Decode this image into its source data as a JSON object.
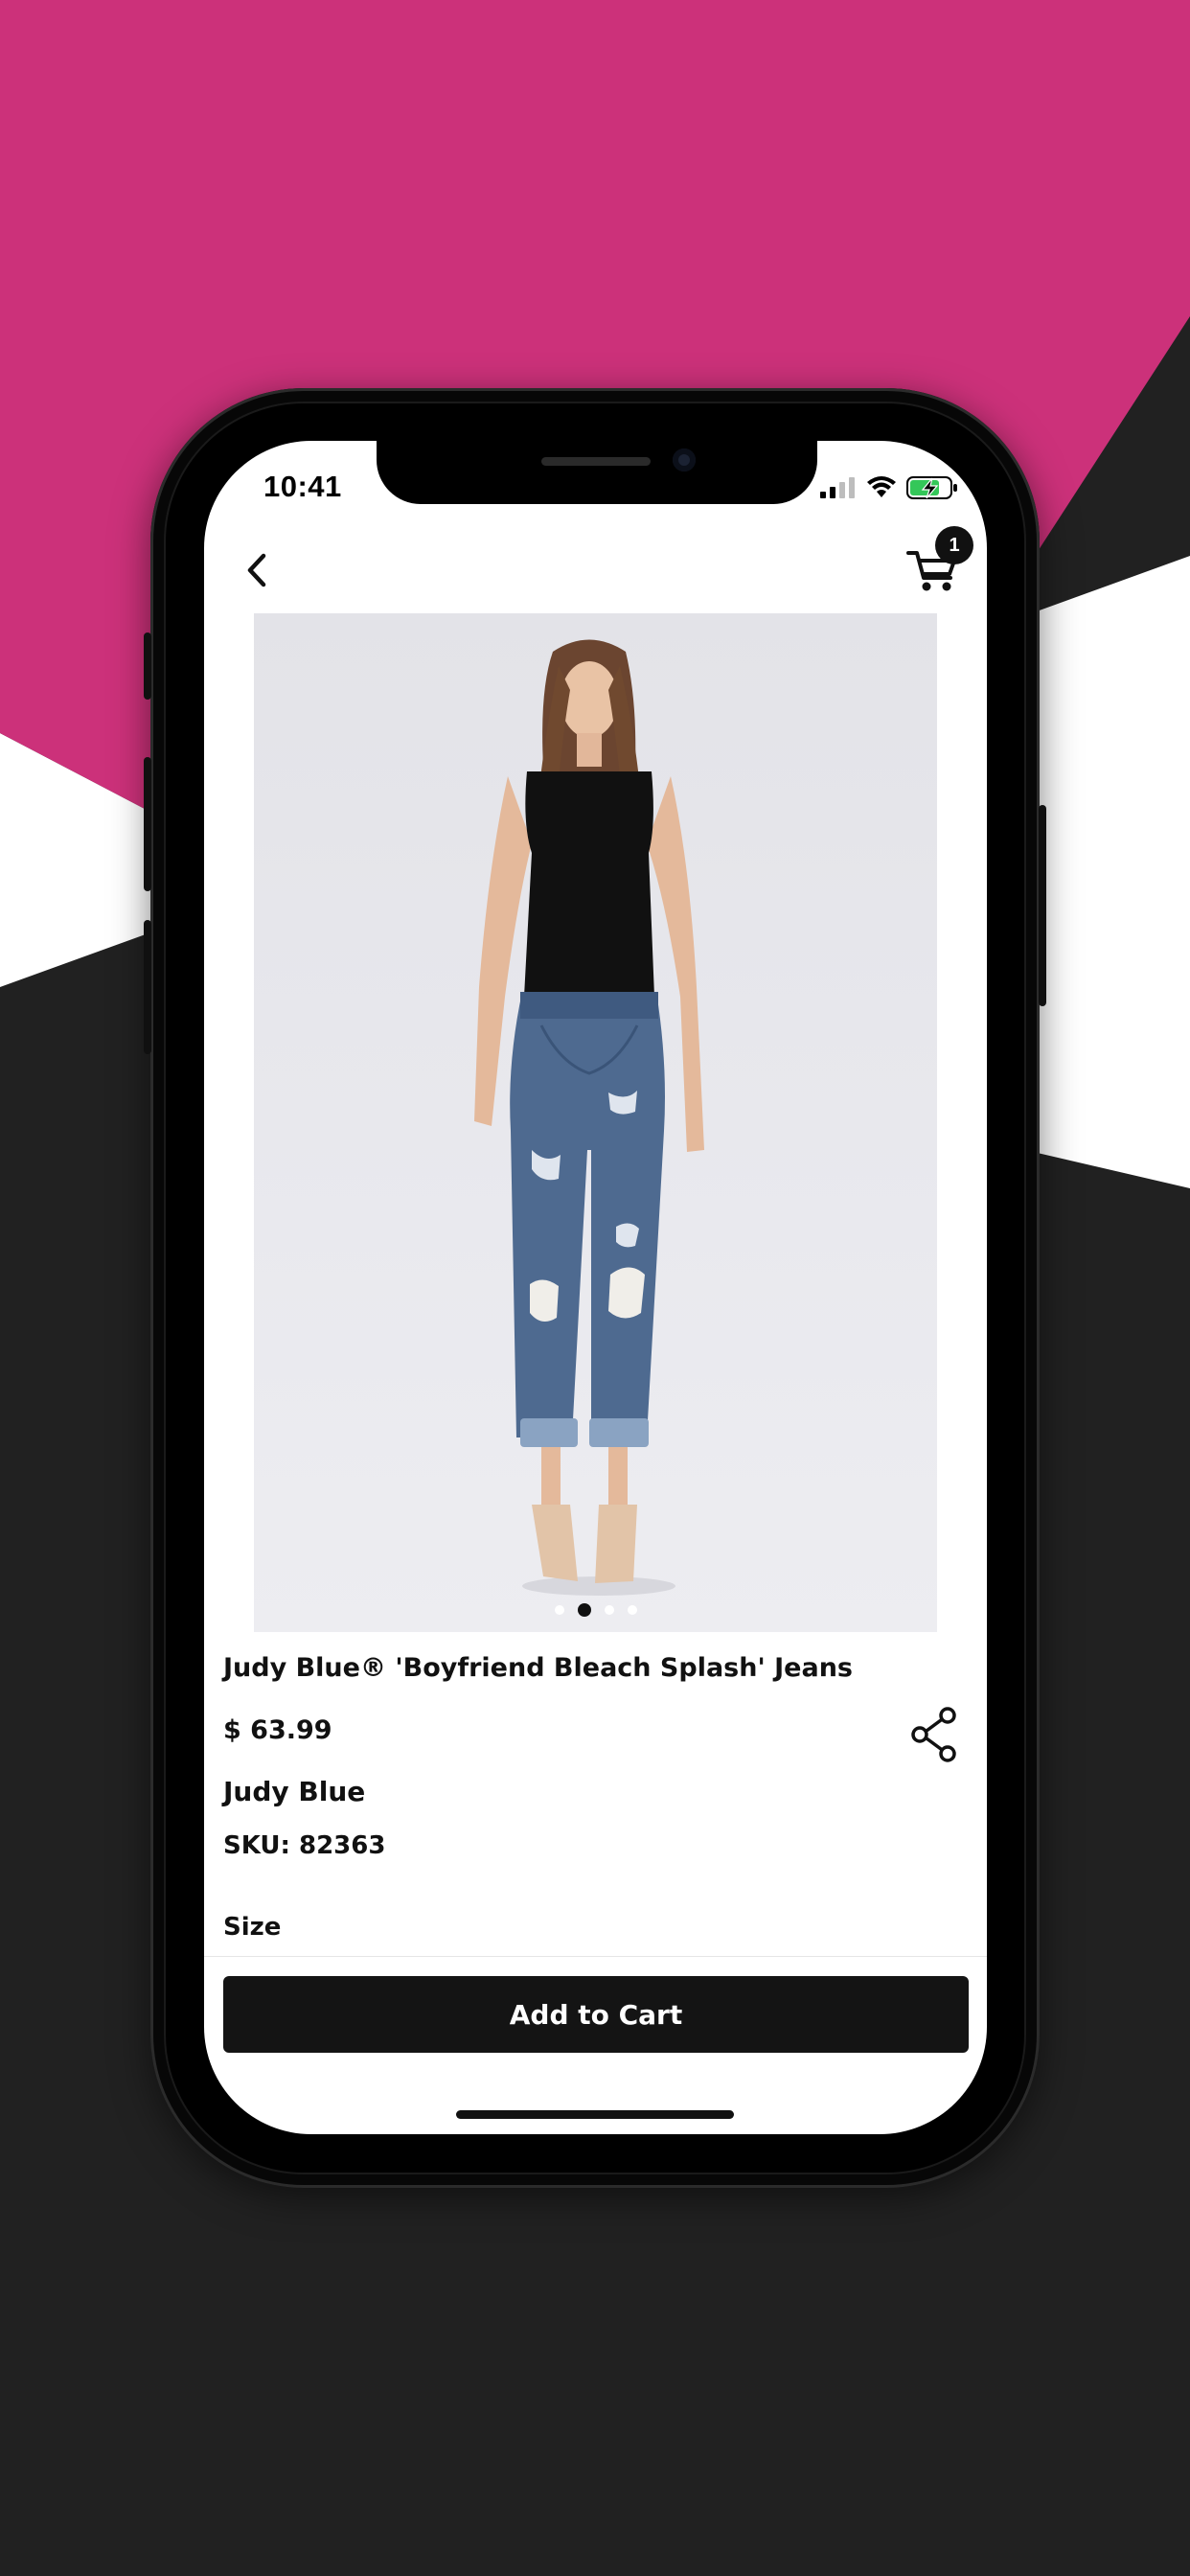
{
  "colors": {
    "background_dark": "#212121",
    "background_magenta": "#CC317A",
    "stripe": "#FFFFFF",
    "button": "#141414",
    "battery_green": "#34C759"
  },
  "status_bar": {
    "time": "10:41",
    "icons": [
      "cellular-signal-icon",
      "wifi-icon",
      "battery-charging-icon"
    ]
  },
  "nav": {
    "back_icon": "chevron-left-icon",
    "cart_icon": "shopping-cart-icon",
    "cart_count": "1"
  },
  "carousel": {
    "image": "product-photo-jeans",
    "total_slides": 4,
    "active_index": 1
  },
  "product": {
    "title": "Judy Blue® 'Boyfriend Bleach Splash' Jeans",
    "price": "$ 63.99",
    "brand": "Judy Blue",
    "sku": "SKU: 82363",
    "size_label": "Size",
    "share_icon": "share-icon"
  },
  "actions": {
    "add_to_cart": "Add to Cart"
  }
}
